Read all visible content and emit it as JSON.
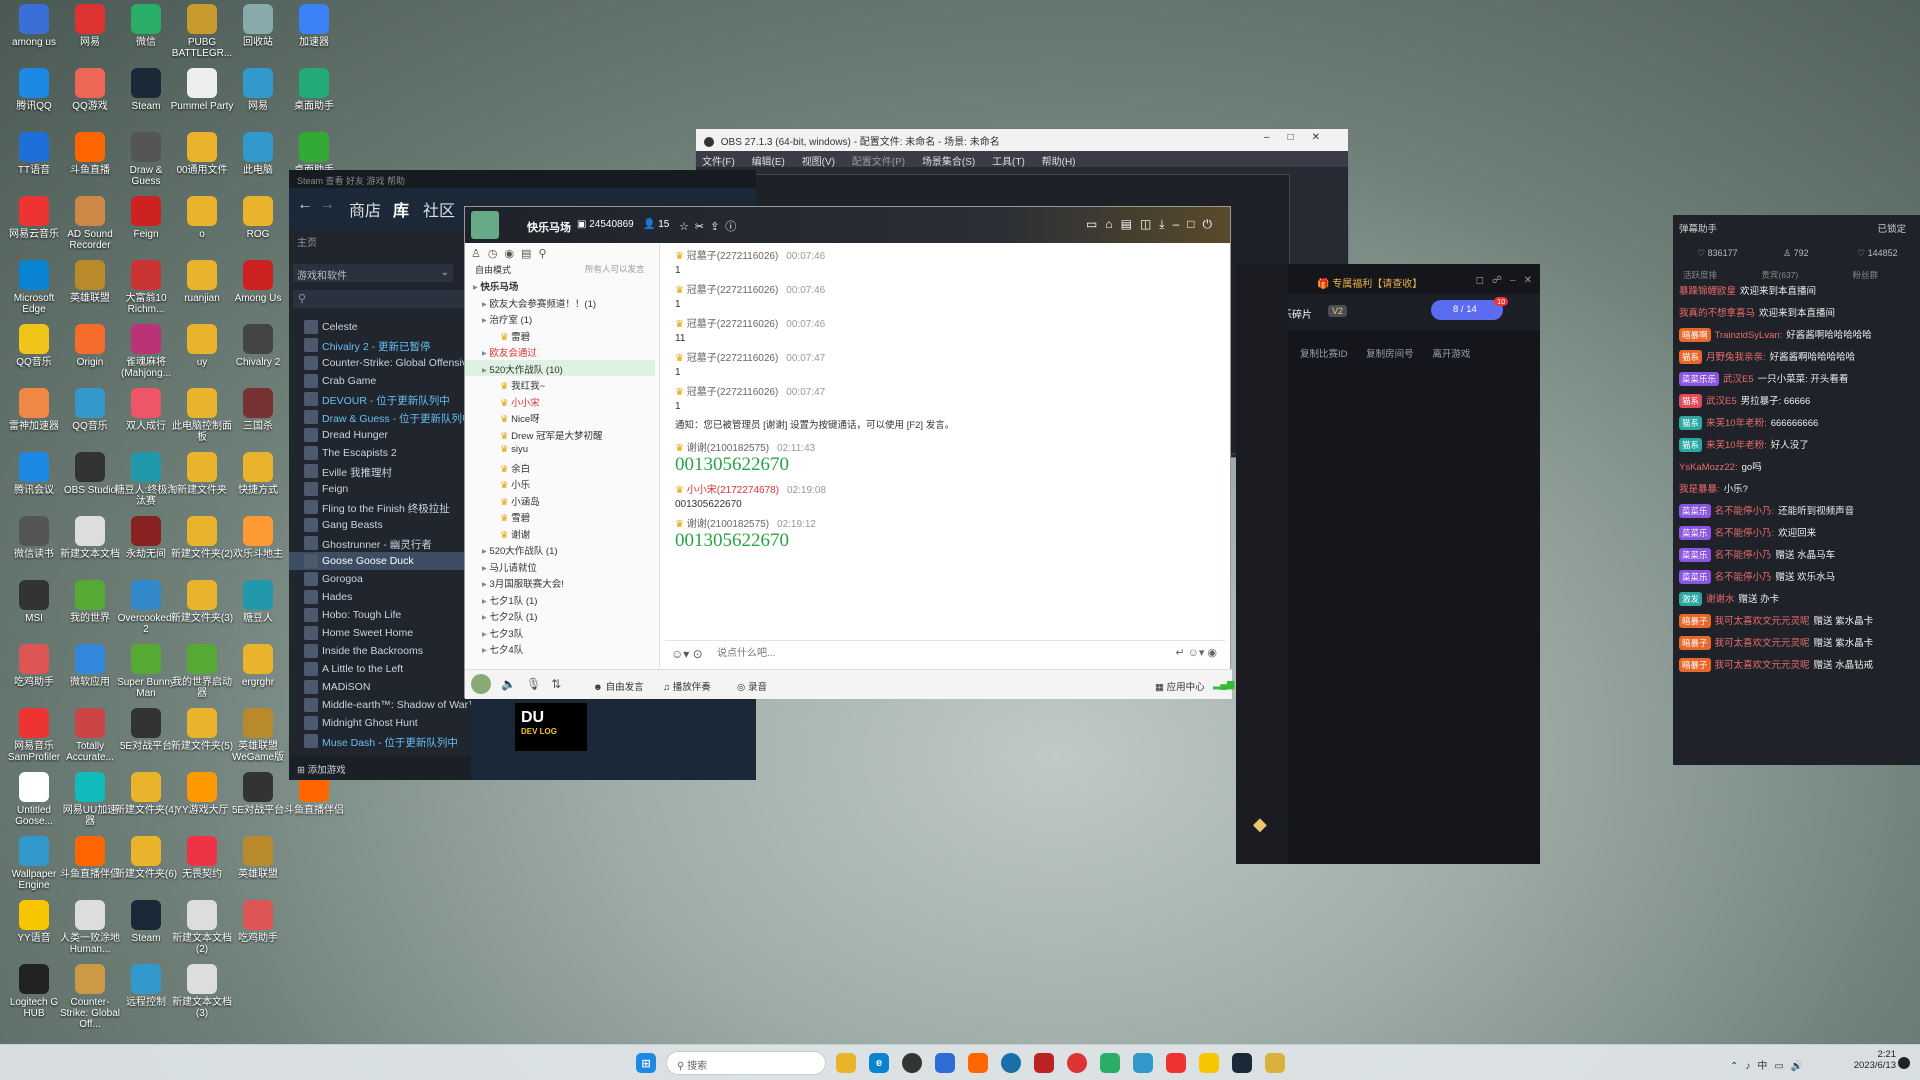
{
  "desktop_icons": [
    {
      "label": "among us",
      "c": "#3a6fd8"
    },
    {
      "label": "网易",
      "c": "#d33"
    },
    {
      "label": "微信",
      "c": "#2aae67"
    },
    {
      "label": "PUBG BATTLEGR...",
      "c": "#c99a2e"
    },
    {
      "label": "回收站",
      "c": "#8aa"
    },
    {
      "label": "加速器",
      "c": "#3b82f6"
    },
    {
      "label": "腾讯QQ",
      "c": "#1e88e5"
    },
    {
      "label": "QQ游戏",
      "c": "#e65"
    },
    {
      "label": "Steam",
      "c": "#1b2838"
    },
    {
      "label": "Pummel Party",
      "c": "#eee"
    },
    {
      "label": "网易",
      "c": "#39c"
    },
    {
      "label": "桌面助手",
      "c": "#2a7"
    },
    {
      "label": "TT语音",
      "c": "#1e6fd8"
    },
    {
      "label": "斗鱼直播",
      "c": "#f60"
    },
    {
      "label": "Draw & Guess",
      "c": "#555"
    },
    {
      "label": "00通用文件",
      "c": "#e9b42c"
    },
    {
      "label": "此电脑",
      "c": "#39c"
    },
    {
      "label": "桌面助手",
      "c": "#3a3"
    },
    {
      "label": "网易云音乐",
      "c": "#e33"
    },
    {
      "label": "AD Sound Recorder",
      "c": "#c84"
    },
    {
      "label": "Feign",
      "c": "#c22"
    },
    {
      "label": "o",
      "c": "#e9b42c"
    },
    {
      "label": "ROG",
      "c": "#e9b42c"
    },
    {
      "label": "Microsoft Edge",
      "c": "#0a84d0"
    },
    {
      "label": "英雄联盟",
      "c": "#b88a2a"
    },
    {
      "label": "大富翁10 Richm...",
      "c": "#c33"
    },
    {
      "label": "ruanjian",
      "c": "#e9b42c"
    },
    {
      "label": "Among Us",
      "c": "#c22"
    },
    {
      "label": "QQ音乐",
      "c": "#f0c419"
    },
    {
      "label": "Origin",
      "c": "#f56c2d"
    },
    {
      "label": "雀魂麻将 (Mahjong...",
      "c": "#b37"
    },
    {
      "label": "uy",
      "c": "#e9b42c"
    },
    {
      "label": "Chivalry 2",
      "c": "#444"
    },
    {
      "label": "雷神加速器",
      "c": "#e84"
    },
    {
      "label": "QQ音乐",
      "c": "#39c"
    },
    {
      "label": "双人成行",
      "c": "#e56"
    },
    {
      "label": "此电脑控制面板",
      "c": "#e9b42c"
    },
    {
      "label": "三国杀",
      "c": "#733"
    },
    {
      "label": "腾讯会议",
      "c": "#1e88e5"
    },
    {
      "label": "OBS Studio",
      "c": "#333"
    },
    {
      "label": "糖豆人:终极淘汰赛",
      "c": "#29a"
    },
    {
      "label": "新建文件夹",
      "c": "#e9b42c"
    },
    {
      "label": "快捷方式",
      "c": "#e9b42c"
    },
    {
      "label": "微信读书",
      "c": "#555"
    },
    {
      "label": "新建文本文档",
      "c": "#ddd"
    },
    {
      "label": "永劫无间",
      "c": "#822"
    },
    {
      "label": "新建文件夹(2)",
      "c": "#e9b42c"
    },
    {
      "label": "欢乐斗地主",
      "c": "#f93"
    },
    {
      "label": "MSI",
      "c": "#333"
    },
    {
      "label": "我的世界",
      "c": "#5a3"
    },
    {
      "label": "Overcooked! 2",
      "c": "#38c"
    },
    {
      "label": "新建文件夹(3)",
      "c": "#e9b42c"
    },
    {
      "label": "糖豆人",
      "c": "#29a"
    },
    {
      "label": "吃鸡助手",
      "c": "#d55"
    },
    {
      "label": "微软应用",
      "c": "#38d"
    },
    {
      "label": "Super Bunny Man",
      "c": "#5a3"
    },
    {
      "label": "我的世界启动器",
      "c": "#5a3"
    },
    {
      "label": "ergrghr",
      "c": "#e9b42c"
    },
    {
      "label": "Microsoft Edge",
      "c": "#0a84d0"
    },
    {
      "label": "网易音乐 SamProfiler",
      "c": "#e33"
    },
    {
      "label": "Totally Accurate...",
      "c": "#c44"
    },
    {
      "label": "5E对战平台",
      "c": "#333"
    },
    {
      "label": "新建文件夹(5)",
      "c": "#e9b42c"
    },
    {
      "label": "英雄联盟 WeGame版",
      "c": "#b88a2a"
    },
    {
      "label": "网易云音乐",
      "c": "#e33"
    },
    {
      "label": "Untitled Goose...",
      "c": "#fff"
    },
    {
      "label": "网易UU加速器",
      "c": "#1bb"
    },
    {
      "label": "新建文件夹(4)",
      "c": "#e9b42c"
    },
    {
      "label": "YY游戏大厅",
      "c": "#f90"
    },
    {
      "label": "5E对战平台",
      "c": "#333"
    },
    {
      "label": "斗鱼直播伴侣",
      "c": "#f60"
    },
    {
      "label": "Wallpaper Engine",
      "c": "#39c"
    },
    {
      "label": "斗鱼直播伴侣",
      "c": "#f60"
    },
    {
      "label": "新建文件夹(6)",
      "c": "#e9b42c"
    },
    {
      "label": "无畏契约",
      "c": "#e34"
    },
    {
      "label": "英雄联盟",
      "c": "#b88a2a"
    },
    {
      "label": "YY语音",
      "c": "#f7c600"
    },
    {
      "label": "人类一败涂地 Human...",
      "c": "#ddd"
    },
    {
      "label": "Steam",
      "c": "#1b2838"
    },
    {
      "label": "新建文本文档(2)",
      "c": "#ddd"
    },
    {
      "label": "吃鸡助手",
      "c": "#d55"
    },
    {
      "label": "Logitech G HUB",
      "c": "#222"
    },
    {
      "label": "Counter-Strike: Global Off...",
      "c": "#c94"
    },
    {
      "label": "远程控制",
      "c": "#39c"
    },
    {
      "label": "新建文本文档(3)",
      "c": "#ddd"
    }
  ],
  "obs": {
    "title": "OBS 27.1.3 (64-bit, windows) - 配置文件: 未命名 - 场景: 未命名",
    "menu": [
      "文件(F)",
      "编辑(E)",
      "视图(V)",
      "配置文件(P)",
      "场景集合(S)",
      "工具(T)",
      "帮助(H)"
    ]
  },
  "steam": {
    "nav": [
      "商店",
      "库",
      "社区"
    ],
    "home": "主页",
    "filter": "游戏和软件",
    "add_game": "添加游戏",
    "games": [
      {
        "name": "Celeste",
        "style": ""
      },
      {
        "name": "Chivalry 2 - 更新已暂停",
        "style": "bl"
      },
      {
        "name": "Counter-Strike: Global Offensive",
        "style": ""
      },
      {
        "name": "Crab Game",
        "style": ""
      },
      {
        "name": "DEVOUR - 位于更新队列中",
        "style": "bl"
      },
      {
        "name": "Draw & Guess - 位于更新队列中",
        "style": "bl"
      },
      {
        "name": "Dread Hunger",
        "style": ""
      },
      {
        "name": "The Escapists 2",
        "style": ""
      },
      {
        "name": "Eville 我推理村",
        "style": ""
      },
      {
        "name": "Feign",
        "style": ""
      },
      {
        "name": "Fling to the Finish 终极拉扯",
        "style": ""
      },
      {
        "name": "Gang Beasts",
        "style": ""
      },
      {
        "name": "Ghostrunner - 幽灵行者",
        "style": ""
      },
      {
        "name": "Goose Goose Duck",
        "style": "hl"
      },
      {
        "name": "Gorogoa",
        "style": ""
      },
      {
        "name": "Hades",
        "style": ""
      },
      {
        "name": "Hobo: Tough Life",
        "style": ""
      },
      {
        "name": "Home Sweet Home",
        "style": ""
      },
      {
        "name": "Inside the Backrooms",
        "style": ""
      },
      {
        "name": "A Little to the Left",
        "style": ""
      },
      {
        "name": "MADiSON",
        "style": ""
      },
      {
        "name": "Middle-earth™: Shadow of War™",
        "style": ""
      },
      {
        "name": "Midnight Ghost Hunt",
        "style": ""
      },
      {
        "name": "Muse Dash - 位于更新队列中",
        "style": "bl"
      }
    ]
  },
  "yy": {
    "channel_name": "快乐马场",
    "channel_id": "24540869",
    "online": "15",
    "mode": "自由模式",
    "mode_right": "所有人可以发言",
    "tree": [
      {
        "t": "快乐马场",
        "i": 0,
        "b": true
      },
      {
        "t": "欧友大会参赛频道！！(1)",
        "i": 1
      },
      {
        "t": "治疗室 (1)",
        "i": 1
      },
      {
        "t": "雷碧",
        "i": 3
      },
      {
        "t": "欧友会通过",
        "i": 1,
        "red": true
      },
      {
        "t": "520大作战队 (10)",
        "i": 1,
        "hl": true
      },
      {
        "t": "我红我~",
        "i": 3
      },
      {
        "t": "小小宋",
        "i": 3,
        "red": true
      },
      {
        "t": "Nice呀",
        "i": 3
      },
      {
        "t": "Drew 冠军是大梦初醒",
        "i": 3
      },
      {
        "t": "siyu",
        "i": 3
      },
      {
        "t": "余白",
        "i": 3
      },
      {
        "t": "小乐",
        "i": 3
      },
      {
        "t": "小涵岛",
        "i": 3
      },
      {
        "t": "雪碧",
        "i": 3
      },
      {
        "t": "谢谢",
        "i": 3
      },
      {
        "t": "520大作战队 (1)",
        "i": 1
      },
      {
        "t": "马儿请就位",
        "i": 1
      },
      {
        "t": "3月国服联赛大会!",
        "i": 1
      },
      {
        "t": "七夕1队 (1)",
        "i": 1
      },
      {
        "t": "七夕2队 (1)",
        "i": 1
      },
      {
        "t": "七夕3队",
        "i": 1
      },
      {
        "t": "七夕4队",
        "i": 1
      }
    ],
    "messages": [
      {
        "name": "冠墓子(2272116026)",
        "time": "00:07:46",
        "text": "1"
      },
      {
        "name": "冠墓子(2272116026)",
        "time": "00:07:46",
        "text": "1"
      },
      {
        "name": "冠墓子(2272116026)",
        "time": "00:07:46",
        "text": "11"
      },
      {
        "name": "冠墓子(2272116026)",
        "time": "00:07:47",
        "text": "1"
      },
      {
        "name": "冠墓子(2272116026)",
        "time": "00:07:47",
        "text": "1"
      }
    ],
    "notice": "通知：您已被管理员 [谢谢] 设置为按键通话，可以使用 [F2] 发言。",
    "msg2": [
      {
        "name": "谢谢(2100182575)",
        "time": "02:11:43",
        "text": "001305622670",
        "big": true
      },
      {
        "name": "小小宋(2172274678)",
        "time": "02:19:08",
        "text": "001305622670",
        "big": false,
        "red": true
      },
      {
        "name": "谢谢(2100182575)",
        "time": "02:19:12",
        "text": "001305622670",
        "big": true
      }
    ],
    "input_placeholder": "说点什么吧...",
    "bottom": {
      "free": "自由发言",
      "music": "播放伴奏",
      "record": "录音",
      "app": "应用中心"
    }
  },
  "live": {
    "title": "专属福利【请查收】",
    "user": "小乐碎片",
    "level": "V2",
    "members": "8 / 14",
    "badge": "10",
    "actions": [
      "复制比赛ID",
      "复制房间号",
      "离开游戏"
    ]
  },
  "danmu": {
    "title": "弹幕助手",
    "status": "已锁定",
    "stats": [
      "836177",
      "792",
      "144852"
    ],
    "tabs": [
      "活跃度排",
      "贵宾(637)",
      "粉丝群"
    ],
    "rows": [
      {
        "badge": "",
        "user": "暴躁锦鲤欧皇",
        "text": "欢迎来到本直播间",
        "c": "r"
      },
      {
        "badge": "",
        "user": "我真的不想拿喜马",
        "text": "欢迎来到本直播间",
        "c": "r"
      },
      {
        "badge": "暗暴啊",
        "user": "TrainzidSyLvan:",
        "text": "好酱酱啊哈哈哈哈哈",
        "c": ""
      },
      {
        "badge": "猫系",
        "user": "月野兔我亲亲:",
        "text": "好酱酱啊哈哈哈哈哈",
        "c": ""
      },
      {
        "badge": "菜菜乐乐",
        "user": "武汉E5",
        "text": "一只小菜菜: 开头看看",
        "c": "p"
      },
      {
        "badge": "猫系",
        "user": "武汉E5",
        "text": "男拉暴子: 66666",
        "c": "r"
      },
      {
        "badge": "猫系",
        "user": "来芙10年老粉:",
        "text": "666666666",
        "c": "t"
      },
      {
        "badge": "猫系",
        "user": "来芙10年老粉:",
        "text": "好人没了",
        "c": "t"
      },
      {
        "badge": "",
        "user": "YsKaMozz22:",
        "text": "go吗",
        "c": ""
      },
      {
        "badge": "",
        "user": "我是暴暴:",
        "text": "小乐?",
        "c": ""
      },
      {
        "badge": "菜菜乐",
        "user": "名不能停小乃:",
        "text": "还能听到视频声音",
        "c": "p"
      },
      {
        "badge": "菜菜乐",
        "user": "名不能停小乃:",
        "text": "欢迎回来",
        "c": "p"
      },
      {
        "badge": "菜菜乐",
        "user": "名不能停小乃",
        "text": "赠送 水晶马车",
        "c": "p"
      },
      {
        "badge": "菜菜乐",
        "user": "名不能停小乃",
        "text": "赠送 欢乐水马",
        "c": "p"
      },
      {
        "badge": "激发",
        "user": "谢谢水",
        "text": "赠送 办卡",
        "c": "t"
      },
      {
        "badge": "暗暴子",
        "user": "我可太喜欢文元元灵呢",
        "text": "赠送 紫水晶卡",
        "c": ""
      },
      {
        "badge": "暗暴子",
        "user": "我可太喜欢文元元灵呢",
        "text": "赠送 紫水晶卡",
        "c": ""
      },
      {
        "badge": "暗暴子",
        "user": "我可太喜欢文元元灵呢",
        "text": "赠送 水晶钻戒",
        "c": ""
      }
    ]
  },
  "taskbar": {
    "search": "搜索",
    "time": "2:21",
    "date": "2023/6/13",
    "lang": "中"
  }
}
